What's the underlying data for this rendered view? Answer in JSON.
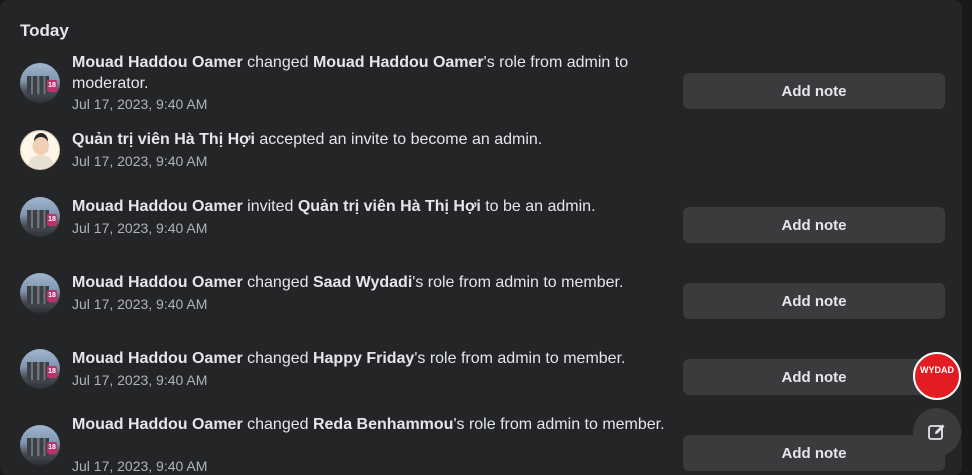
{
  "section": {
    "title": "Today"
  },
  "activity": [
    {
      "actor": "Mouad Haddou Oamer",
      "action": " changed ",
      "target": "Mouad Haddou Oamer",
      "rest": "'s role from admin to moderator.",
      "time": "Jul 17, 2023, 9:40 AM",
      "button": "Add note"
    },
    {
      "actor": "Quản trị viên Hà Thị Hợi",
      "action": " accepted an invite to become an admin.",
      "target": "",
      "rest": "",
      "time": "Jul 17, 2023, 9:40 AM",
      "button": ""
    },
    {
      "actor": "Mouad Haddou Oamer",
      "action": " invited ",
      "target": "Quản trị viên Hà Thị Hợi",
      "rest": " to be an admin.",
      "time": "Jul 17, 2023, 9:40 AM",
      "button": "Add note"
    },
    {
      "actor": "Mouad Haddou Oamer",
      "action": " changed ",
      "target": "Saad Wydadi",
      "rest": "'s role from admin to member.",
      "time": "Jul 17, 2023, 9:40 AM",
      "button": "Add note"
    },
    {
      "actor": "Mouad Haddou Oamer",
      "action": " changed ",
      "target": "Happy Friday",
      "rest": "'s role from admin to member.",
      "time": "Jul 17, 2023, 9:40 AM",
      "button": "Add note"
    },
    {
      "actor": "Mouad Haddou Oamer",
      "action": " changed ",
      "target": "Reda Benhammou",
      "rest": "'s role from admin to member.",
      "time": "Jul 17, 2023, 9:40 AM",
      "button": "Add note"
    }
  ],
  "avatar_badge": "18",
  "floating": {
    "brand_text": "WYDAD",
    "compose_icon": "edit-icon"
  }
}
